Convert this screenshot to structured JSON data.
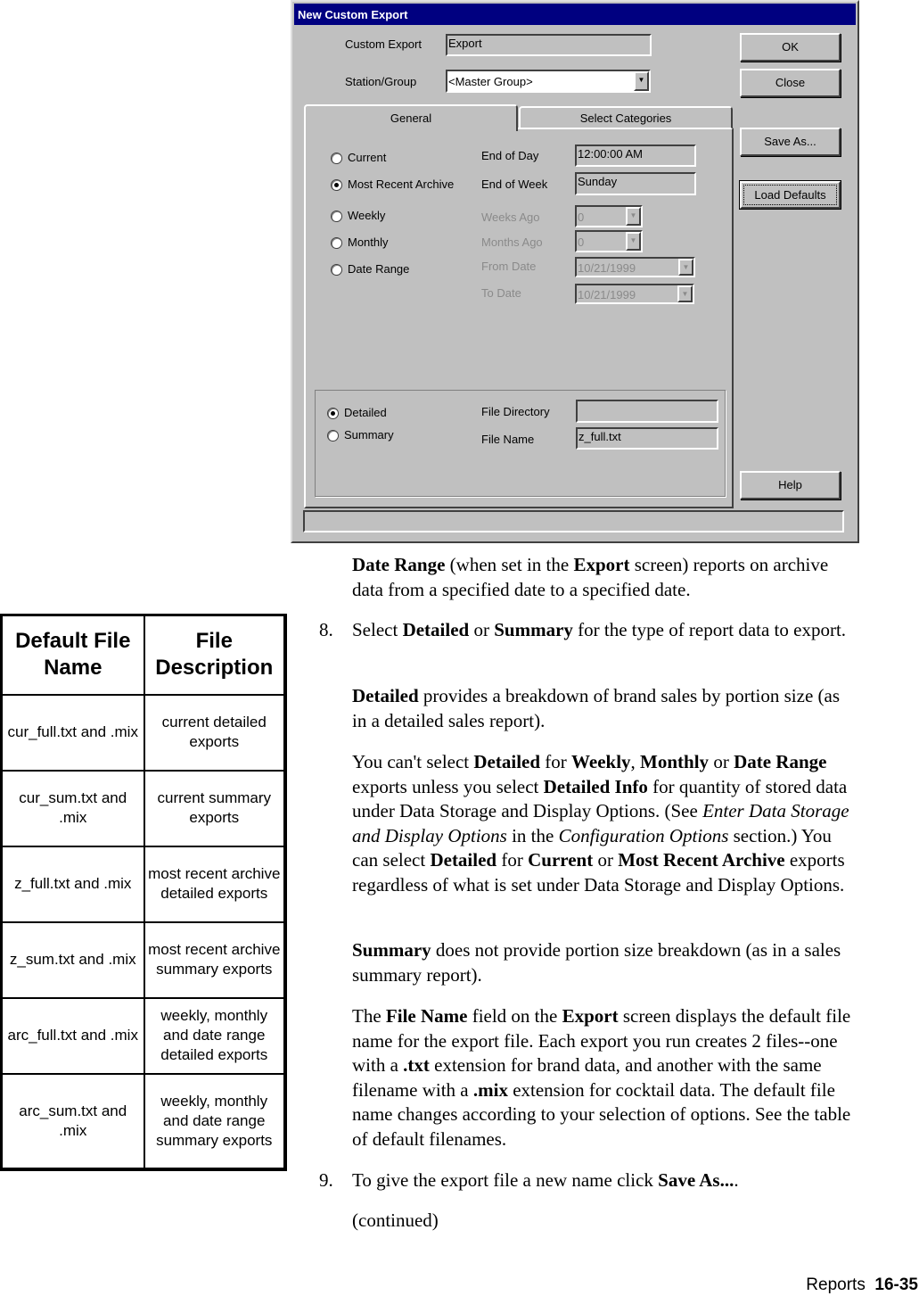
{
  "dialog": {
    "title": "New Custom Export",
    "custom_export_label": "Custom Export",
    "custom_export_value": "Export",
    "station_label": "Station/Group",
    "station_value": "<Master Group>",
    "buttons": {
      "ok": "OK",
      "close": "Close",
      "save_as": "Save As...",
      "load_defaults": "Load Defaults",
      "help": "Help"
    },
    "tabs": [
      "General",
      "Select Categories"
    ],
    "radios": [
      {
        "label": "Current",
        "checked": false
      },
      {
        "label": "Most Recent Archive",
        "checked": true
      },
      {
        "label": "Weekly",
        "checked": false
      },
      {
        "label": "Monthly",
        "checked": false
      },
      {
        "label": "Date Range",
        "checked": false
      }
    ],
    "fields": {
      "end_of_day_label": "End of Day",
      "end_of_day": "12:00:00 AM",
      "end_of_week_label": "End of Week",
      "end_of_week": "Sunday",
      "weeks_ago_label": "Weeks Ago",
      "weeks_ago": "0",
      "months_ago_label": "Months Ago",
      "months_ago": "0",
      "from_date_label": "From Date",
      "from_date": "10/21/1999",
      "to_date_label": "To Date",
      "to_date": "10/21/1999"
    },
    "type_radios": [
      {
        "label": "Detailed",
        "checked": true
      },
      {
        "label": "Summary",
        "checked": false
      }
    ],
    "file_directory_label": "File Directory",
    "file_directory": "",
    "file_name_label": "File Name",
    "file_name": "z_full.txt",
    "status": ""
  },
  "table": {
    "headers": [
      "Default File Name",
      "File Description"
    ],
    "rows": [
      [
        "cur_full.txt and .mix",
        "current detailed exports"
      ],
      [
        "cur_sum.txt and .mix",
        "current summary exports"
      ],
      [
        "z_full.txt and .mix",
        "most recent archive detailed exports"
      ],
      [
        "z_sum.txt and .mix",
        "most recent archive summary exports"
      ],
      [
        "arc_full.txt and .mix",
        "weekly, monthly and date range detailed exports"
      ],
      [
        "arc_sum.txt and .mix",
        "weekly, monthly and date range summary exports"
      ]
    ]
  },
  "text": {
    "paragraphs": [
      [
        [
          "b",
          "Date Range"
        ],
        [
          "n",
          " (when set in the "
        ],
        [
          "b",
          "Export"
        ],
        [
          "n",
          " screen) reports on archive data from a specified date to a specified date."
        ]
      ],
      [
        [
          "n",
          "Select "
        ],
        [
          "b",
          "Detailed"
        ],
        [
          "n",
          " or "
        ],
        [
          "b",
          "Summary"
        ],
        [
          "n",
          " for the type of report data to export."
        ]
      ],
      [
        [
          "b",
          "Detailed"
        ],
        [
          "n",
          " provides a breakdown of brand sales by portion size (as in a detailed sales report)."
        ]
      ],
      [
        [
          "n",
          "You can't select "
        ],
        [
          "b",
          "Detailed"
        ],
        [
          "n",
          " for "
        ],
        [
          "b",
          "Weekly"
        ],
        [
          "n",
          ", "
        ],
        [
          "b",
          "Monthly"
        ],
        [
          "n",
          " or "
        ],
        [
          "b",
          "Date Range"
        ],
        [
          "n",
          " exports unless you select "
        ],
        [
          "b",
          "Detailed Info"
        ],
        [
          "n",
          " for quantity of stored data under Data Storage and Display Options. (See "
        ],
        [
          "i",
          "Enter Data Storage and Display Options"
        ],
        [
          "n",
          " in the "
        ],
        [
          "i",
          "Configuration Options"
        ],
        [
          "n",
          " section.) You can select "
        ],
        [
          "b",
          "Detailed"
        ],
        [
          "n",
          " for "
        ],
        [
          "b",
          "Current"
        ],
        [
          "n",
          " or "
        ],
        [
          "b",
          "Most Recent Archive"
        ],
        [
          "n",
          " exports regardless of what is set under Data Storage and Display Options."
        ]
      ],
      [
        [
          "b",
          "Summary"
        ],
        [
          "n",
          " does not provide portion size breakdown (as in a sales summary report)."
        ]
      ],
      [
        [
          "n",
          "The "
        ],
        [
          "b",
          "File Name"
        ],
        [
          "n",
          " field on the "
        ],
        [
          "b",
          "Export"
        ],
        [
          "n",
          " screen displays the default file name for the export file. Each export you run creates 2 files--one with a "
        ],
        [
          "b",
          ".txt"
        ],
        [
          "n",
          " extension for brand data, and another with the same filename with a "
        ],
        [
          "b",
          ".mix"
        ],
        [
          "n",
          " extension for cocktail data. The default file name changes according to your selection of options. See the table of default filenames."
        ]
      ],
      [
        [
          "n",
          "To give the export file a new name click "
        ],
        [
          "b",
          "Save As..."
        ],
        [
          "n",
          "."
        ]
      ],
      [
        [
          "n",
          "(continued)"
        ]
      ]
    ],
    "step_numbers": [
      "8.",
      "9."
    ]
  },
  "footer": {
    "section": "Reports",
    "page": "16-35"
  }
}
